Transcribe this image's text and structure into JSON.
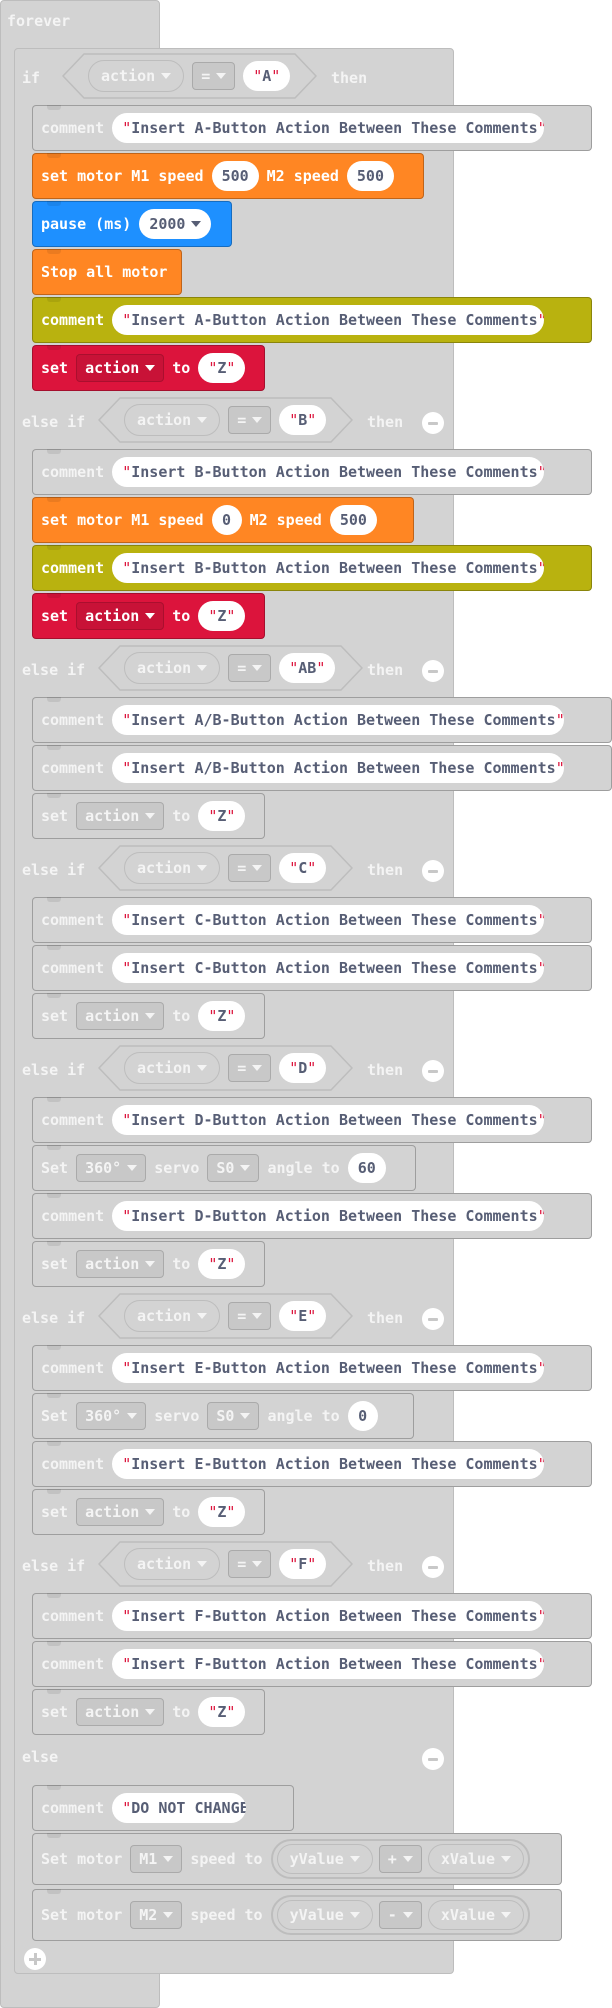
{
  "forever_label": "forever",
  "if_label": "if",
  "then_label": "then",
  "else_if_label": "else if",
  "else_label": "else",
  "comment_label": "comment",
  "to_label": "to",
  "var_action": "action",
  "op_eq": "=",
  "quote": "\"",
  "branches": [
    {
      "key": "A",
      "kind": "if"
    },
    {
      "key": "B",
      "kind": "else if"
    },
    {
      "key": "AB",
      "kind": "else if"
    },
    {
      "key": "C",
      "kind": "else if"
    },
    {
      "key": "D",
      "kind": "else if"
    },
    {
      "key": "E",
      "kind": "else if"
    },
    {
      "key": "F",
      "kind": "else if"
    }
  ],
  "comments": {
    "A": "Insert A-Button Action Between These Comments",
    "B": "Insert B-Button Action Between These Comments",
    "AB": "Insert A/B-Button Action Between These Comments",
    "C": "Insert C-Button Action Between These Comments",
    "D": "Insert D-Button Action Between These Comments",
    "E": "Insert E-Button Action Between These Comments",
    "F": "Insert F-Button Action Between These Comments",
    "else": "DO NOT CHANGE!"
  },
  "set_value": "Z",
  "motor_a": {
    "label1": "set motor M1 speed",
    "m1": "500",
    "label2": "M2 speed",
    "m2": "500"
  },
  "pause": {
    "label": "pause (ms)",
    "value": "2000"
  },
  "stop_all": "Stop all motor",
  "motor_b": {
    "label1": "set motor M1 speed",
    "m1": "0",
    "label2": "M2 speed",
    "m2": "500"
  },
  "servo_d": {
    "set": "Set",
    "type": "360°",
    "servo": "servo",
    "port": "S0",
    "angle": "angle to",
    "value": "60"
  },
  "servo_e": {
    "set": "Set",
    "type": "360°",
    "servo": "servo",
    "port": "S0",
    "angle": "angle to",
    "value": "0"
  },
  "set_lower": "set",
  "motor_final": [
    {
      "set": "Set motor",
      "motor": "M1",
      "speed": "speed to",
      "left": "yValue",
      "op": "+",
      "right": "xValue"
    },
    {
      "set": "Set motor",
      "motor": "M2",
      "speed": "speed to",
      "left": "yValue",
      "op": "-",
      "right": "xValue"
    }
  ],
  "colors": {
    "inactive": "#d3d3d3",
    "motor": "#ff8623",
    "pause": "#1e90ff",
    "comment_active": "#b9b20f",
    "set_active": "#dc143c"
  },
  "icons": [
    "chevron-down-icon",
    "minus-circle-icon",
    "plus-circle-icon"
  ]
}
